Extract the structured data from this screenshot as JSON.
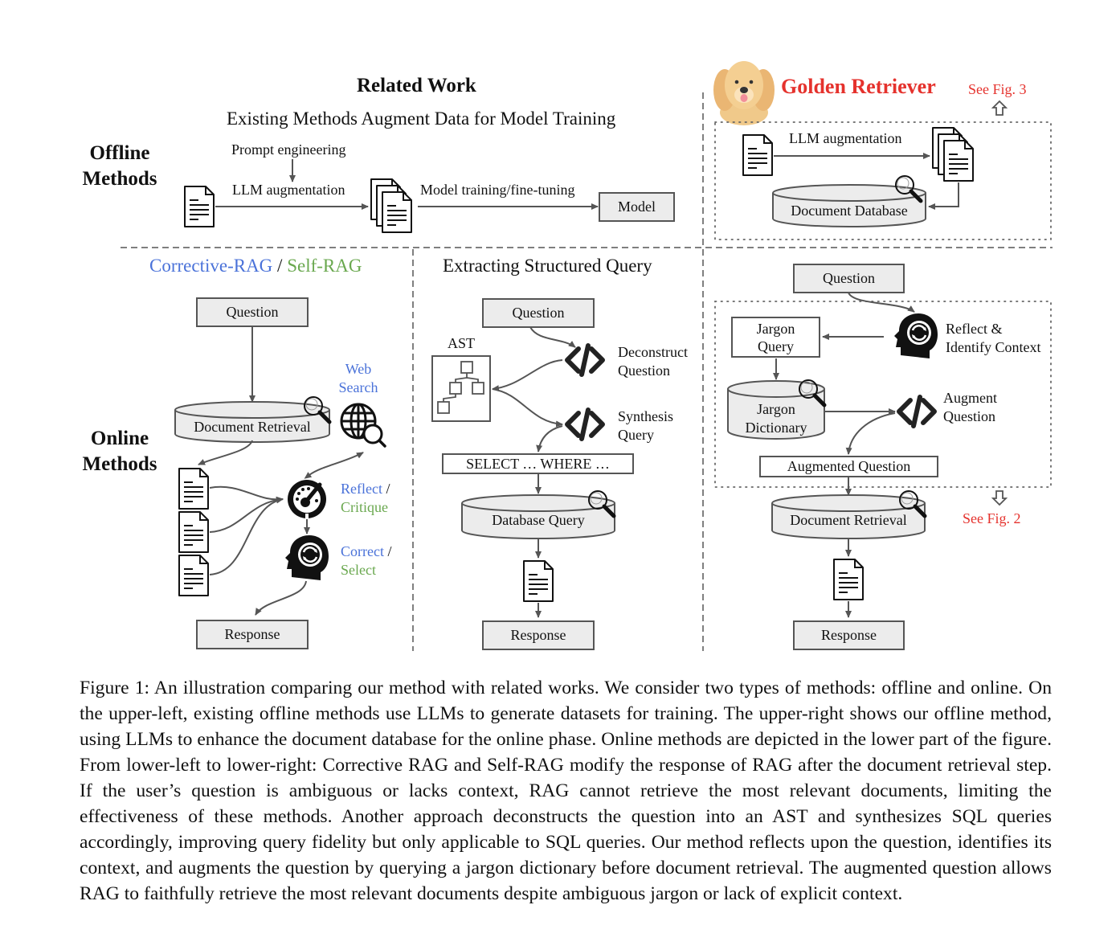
{
  "related_work": {
    "title": "Related Work",
    "subtitle": "Existing Methods Augment Data for Model Training",
    "prompt_engineering": "Prompt engineering",
    "llm_augmentation": "LLM augmentation",
    "model_training": "Model training/fine-tuning",
    "model": "Model"
  },
  "row_labels": {
    "offline": [
      "Offline",
      "Methods"
    ],
    "online": [
      "Online",
      "Methods"
    ]
  },
  "golden_retriever": {
    "title": "Golden Retriever",
    "see_fig3": "See Fig. 3",
    "llm_augmentation": "LLM augmentation",
    "document_database": "Document Database",
    "question": "Question",
    "jargon_query": [
      "Jargon",
      "Query"
    ],
    "reflect": [
      "Reflect &",
      "Identify Context"
    ],
    "jargon_dictionary": [
      "Jargon",
      "Dictionary"
    ],
    "augment_question": [
      "Augment",
      "Question"
    ],
    "augmented_question": "Augmented Question",
    "document_retrieval": "Document Retrieval",
    "see_fig2": "See Fig. 2",
    "response": "Response"
  },
  "corrective": {
    "title_part1": "Corrective-RAG",
    "title_sep": " / ",
    "title_part2": "Self-RAG",
    "question": "Question",
    "web_search": [
      "Web",
      "Search"
    ],
    "document_retrieval": "Document Retrieval",
    "reflect": "Reflect",
    "reflect_sep": " /",
    "critique": "Critique",
    "correct": "Correct",
    "correct_sep": " /",
    "select": "Select",
    "response": "Response"
  },
  "structured": {
    "title": "Extracting Structured Query",
    "question": "Question",
    "ast": "AST",
    "deconstruct": [
      "Deconstruct",
      "Question"
    ],
    "synthesis": [
      "Synthesis",
      "Query"
    ],
    "sql": "SELECT … WHERE …",
    "database_query": "Database Query",
    "response": "Response"
  },
  "colors": {
    "blue": "#4a72d9",
    "green": "#6aa84f",
    "red": "#e5322d",
    "box_fill": "#ececec",
    "line": "#555555"
  },
  "caption": "Figure 1: An illustration comparing our method with related works. We consider two types of methods: offline and online. On the upper-left, existing offline methods use LLMs to generate datasets for training. The upper-right shows our offline method, using LLMs to enhance the document database for the online phase. Online methods are depicted in the lower part of the figure. From lower-left to lower-right: Corrective RAG and Self-RAG modify the response of RAG after the document retrieval step. If the user’s question is ambiguous or lacks context, RAG cannot retrieve the most relevant documents, limiting the effectiveness of these methods. Another approach deconstructs the question into an AST and synthesizes SQL queries accordingly, improving query fidelity but only applicable to SQL queries. Our method reflects upon the question, identifies its context, and augments the question by querying a jargon dictionary before document retrieval. The augmented question allows RAG to faithfully retrieve the most relevant documents despite ambiguous jargon or lack of explicit context."
}
